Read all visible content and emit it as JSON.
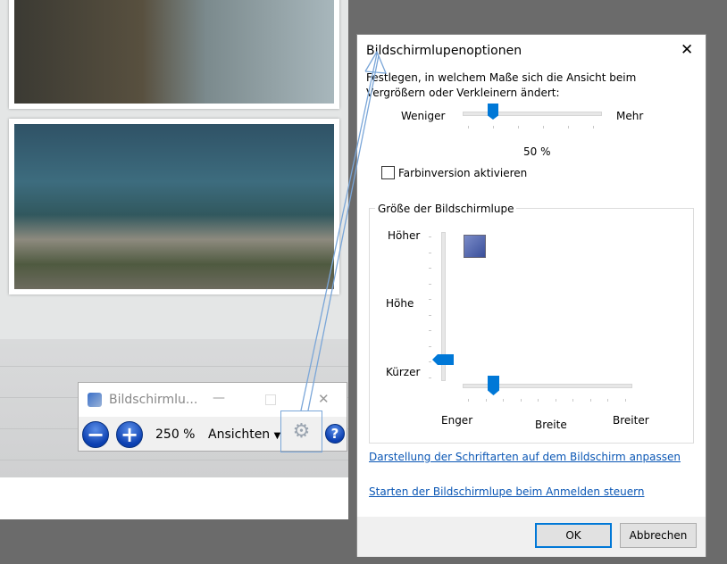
{
  "magnifier": {
    "title": "Bildschirmlu...",
    "zoom": "250 %",
    "views_label": "Ansichten",
    "minimize": "—",
    "close": "✕"
  },
  "dialog": {
    "title": "Bildschirmlupenoptionen",
    "close": "✕",
    "description": "Festlegen, in welchem Maße sich die Ansicht beim Vergrößern oder Verkleinern ändert:",
    "zoom_slider": {
      "min_label": "Weniger",
      "max_label": "Mehr",
      "value": "50 %",
      "position_fraction": 0.2
    },
    "color_inversion": {
      "label": "Farbinversion aktivieren",
      "checked": false
    },
    "size_group": {
      "title": "Größe der Bildschirmlupe",
      "height_top": "Höher",
      "height_label": "Höhe",
      "height_bottom": "Kürzer",
      "width_left": "Enger",
      "width_label": "Breite",
      "width_right": "Breiter",
      "height_fraction": 0.1,
      "width_fraction": 0.18
    },
    "link_fonts": "Darstellung der Schriftarten auf dem Bildschirm anpassen",
    "link_startup": "Starten der Bildschirmlupe beim Anmelden steuern",
    "ok": "OK",
    "cancel": "Abbrechen"
  },
  "colors": {
    "accent": "#0078d7",
    "link": "#0b57b5"
  }
}
